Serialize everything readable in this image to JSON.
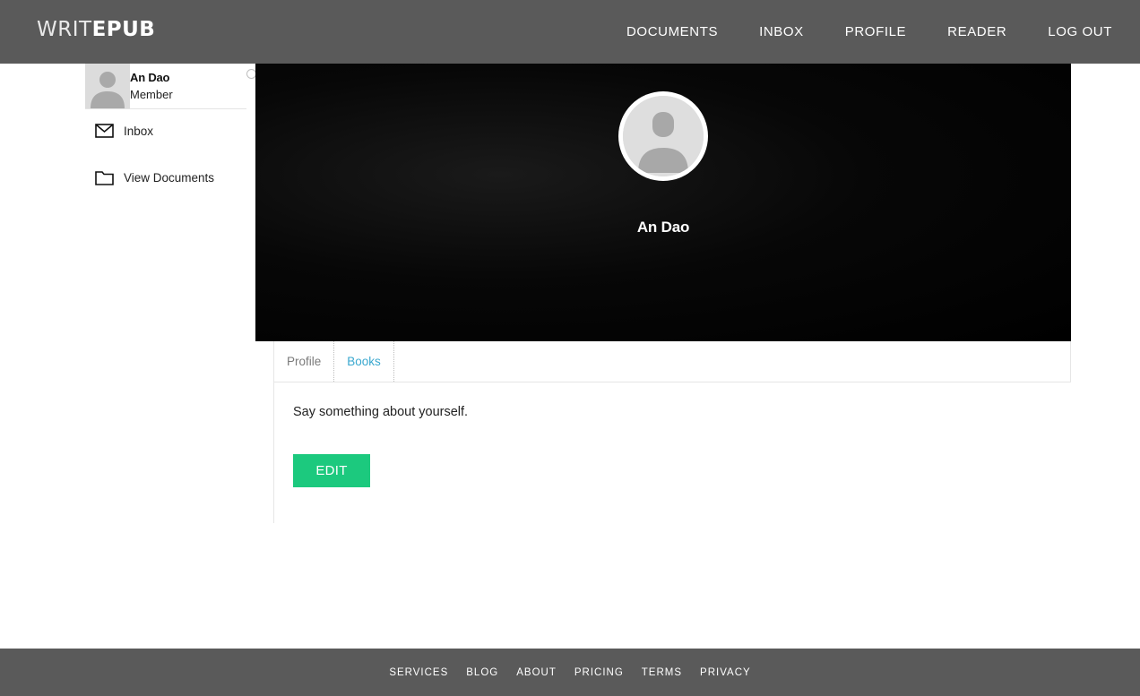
{
  "header": {
    "logo_light": "WRIT",
    "logo_bold": "EPUB",
    "nav": [
      "DOCUMENTS",
      "INBOX",
      "PROFILE",
      "READER",
      "LOG OUT"
    ]
  },
  "sidebar": {
    "user": {
      "name": "An Dao",
      "role": "Member"
    },
    "items": [
      {
        "label": "Inbox",
        "icon": "envelope-icon"
      },
      {
        "label": "View Documents",
        "icon": "folder-icon"
      }
    ]
  },
  "cover": {
    "name": "An Dao"
  },
  "tabs": [
    {
      "label": "Profile"
    },
    {
      "label": "Books",
      "active": true
    }
  ],
  "content": {
    "about": "Say something about yourself.",
    "edit_label": "EDIT"
  },
  "footer": {
    "links": [
      "SERVICES",
      "BLOG",
      "ABOUT",
      "PRICING",
      "TERMS",
      "PRIVACY"
    ]
  },
  "colors": {
    "header_bg": "#5a5a5a",
    "accent_green": "#1cc97e",
    "tab_active": "#3aa8cf"
  }
}
